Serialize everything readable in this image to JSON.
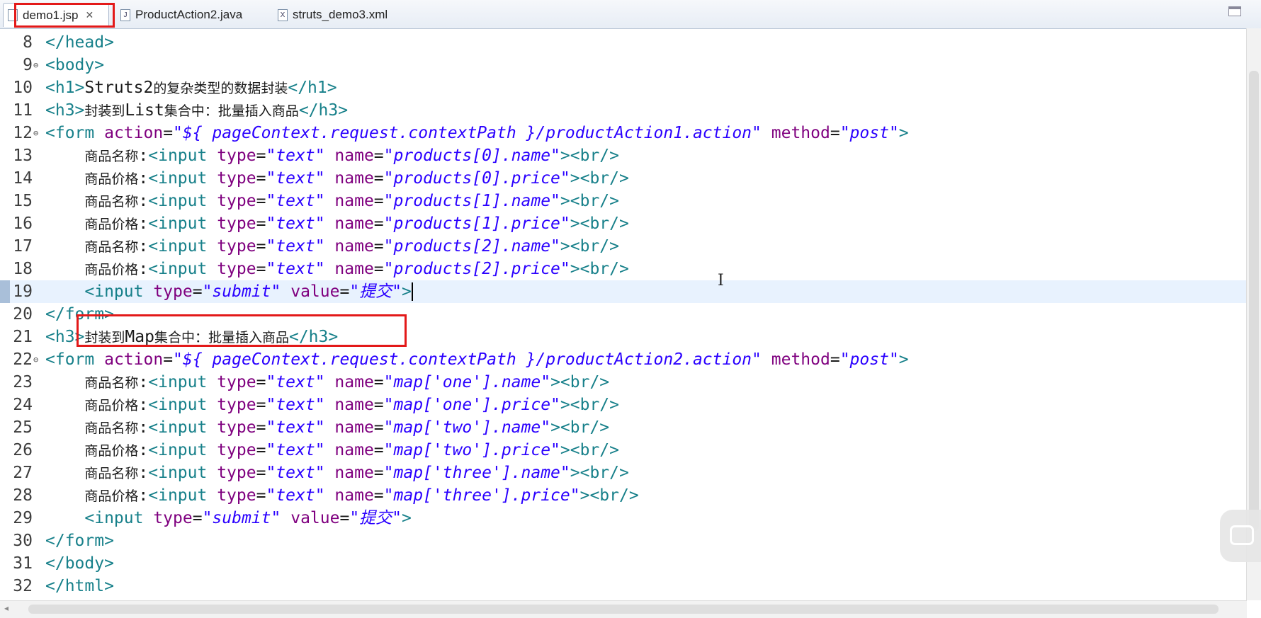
{
  "tabs": [
    {
      "label": "demo1.jsp",
      "icon": "jsp-file-icon",
      "active": true
    },
    {
      "label": "ProductAction2.java",
      "icon": "java-file-icon",
      "active": false
    },
    {
      "label": "struts_demo3.xml",
      "icon": "xml-file-icon",
      "active": false
    }
  ],
  "current_line": 19,
  "highlight_color": "#e31919",
  "lines": [
    {
      "n": "8",
      "t": [
        [
          "tag",
          "</head>"
        ]
      ]
    },
    {
      "n": "9",
      "fold": true,
      "t": [
        [
          "tag",
          "<body>"
        ]
      ]
    },
    {
      "n": "10",
      "t": [
        [
          "tag",
          "<h1>"
        ],
        [
          "txt",
          "Struts2"
        ],
        [
          "cjk",
          "的复杂类型的数据封装"
        ],
        [
          "tag",
          "</h1>"
        ]
      ]
    },
    {
      "n": "11",
      "t": [
        [
          "tag",
          "<h3>"
        ],
        [
          "cjk",
          "封装到"
        ],
        [
          "txt",
          "List"
        ],
        [
          "cjk",
          "集合中：批量插入商品"
        ],
        [
          "tag",
          "</h3>"
        ]
      ]
    },
    {
      "n": "12",
      "fold": true,
      "t": [
        [
          "tag",
          "<form "
        ],
        [
          "attr",
          "action"
        ],
        [
          "txt",
          "="
        ],
        [
          "str",
          "\"${ pageContext.request.contextPath }/productAction1.action\""
        ],
        [
          "txt",
          " "
        ],
        [
          "attr",
          "method"
        ],
        [
          "txt",
          "="
        ],
        [
          "str",
          "\"post\""
        ],
        [
          "tag",
          ">"
        ]
      ]
    },
    {
      "n": "13",
      "t": [
        [
          "txt",
          "    "
        ],
        [
          "cjk",
          "商品名称"
        ],
        [
          "txt",
          ":"
        ],
        [
          "tag",
          "<input "
        ],
        [
          "attr",
          "type"
        ],
        [
          "txt",
          "="
        ],
        [
          "str",
          "\"text\""
        ],
        [
          "txt",
          " "
        ],
        [
          "attr",
          "name"
        ],
        [
          "txt",
          "="
        ],
        [
          "str",
          "\"products[0].name\""
        ],
        [
          "tag",
          "><br/>"
        ]
      ]
    },
    {
      "n": "14",
      "t": [
        [
          "txt",
          "    "
        ],
        [
          "cjk",
          "商品价格"
        ],
        [
          "txt",
          ":"
        ],
        [
          "tag",
          "<input "
        ],
        [
          "attr",
          "type"
        ],
        [
          "txt",
          "="
        ],
        [
          "str",
          "\"text\""
        ],
        [
          "txt",
          " "
        ],
        [
          "attr",
          "name"
        ],
        [
          "txt",
          "="
        ],
        [
          "str",
          "\"products[0].price\""
        ],
        [
          "tag",
          "><br/>"
        ]
      ]
    },
    {
      "n": "15",
      "t": [
        [
          "txt",
          "    "
        ],
        [
          "cjk",
          "商品名称"
        ],
        [
          "txt",
          ":"
        ],
        [
          "tag",
          "<input "
        ],
        [
          "attr",
          "type"
        ],
        [
          "txt",
          "="
        ],
        [
          "str",
          "\"text\""
        ],
        [
          "txt",
          " "
        ],
        [
          "attr",
          "name"
        ],
        [
          "txt",
          "="
        ],
        [
          "str",
          "\"products[1].name\""
        ],
        [
          "tag",
          "><br/>"
        ]
      ]
    },
    {
      "n": "16",
      "t": [
        [
          "txt",
          "    "
        ],
        [
          "cjk",
          "商品价格"
        ],
        [
          "txt",
          ":"
        ],
        [
          "tag",
          "<input "
        ],
        [
          "attr",
          "type"
        ],
        [
          "txt",
          "="
        ],
        [
          "str",
          "\"text\""
        ],
        [
          "txt",
          " "
        ],
        [
          "attr",
          "name"
        ],
        [
          "txt",
          "="
        ],
        [
          "str",
          "\"products[1].price\""
        ],
        [
          "tag",
          "><br/>"
        ]
      ]
    },
    {
      "n": "17",
      "t": [
        [
          "txt",
          "    "
        ],
        [
          "cjk",
          "商品名称"
        ],
        [
          "txt",
          ":"
        ],
        [
          "tag",
          "<input "
        ],
        [
          "attr",
          "type"
        ],
        [
          "txt",
          "="
        ],
        [
          "str",
          "\"text\""
        ],
        [
          "txt",
          " "
        ],
        [
          "attr",
          "name"
        ],
        [
          "txt",
          "="
        ],
        [
          "str",
          "\"products[2].name\""
        ],
        [
          "tag",
          "><br/>"
        ]
      ]
    },
    {
      "n": "18",
      "t": [
        [
          "txt",
          "    "
        ],
        [
          "cjk",
          "商品价格"
        ],
        [
          "txt",
          ":"
        ],
        [
          "tag",
          "<input "
        ],
        [
          "attr",
          "type"
        ],
        [
          "txt",
          "="
        ],
        [
          "str",
          "\"text\""
        ],
        [
          "txt",
          " "
        ],
        [
          "attr",
          "name"
        ],
        [
          "txt",
          "="
        ],
        [
          "str",
          "\"products[2].price\""
        ],
        [
          "tag",
          "><br/>"
        ]
      ]
    },
    {
      "n": "19",
      "t": [
        [
          "txt",
          "    "
        ],
        [
          "tag",
          "<input "
        ],
        [
          "attr",
          "type"
        ],
        [
          "txt",
          "="
        ],
        [
          "str",
          "\"submit\""
        ],
        [
          "txt",
          " "
        ],
        [
          "attr",
          "value"
        ],
        [
          "txt",
          "="
        ],
        [
          "str",
          "\"提交\""
        ],
        [
          "tag",
          ">"
        ]
      ]
    },
    {
      "n": "20",
      "t": [
        [
          "tag",
          "</form>"
        ]
      ]
    },
    {
      "n": "21",
      "t": [
        [
          "tag",
          "<h3>"
        ],
        [
          "cjk",
          "封装到"
        ],
        [
          "txt",
          "Map"
        ],
        [
          "cjk",
          "集合中：批量插入商品"
        ],
        [
          "tag",
          "</h3>"
        ]
      ]
    },
    {
      "n": "22",
      "fold": true,
      "t": [
        [
          "tag",
          "<form "
        ],
        [
          "attr",
          "action"
        ],
        [
          "txt",
          "="
        ],
        [
          "str",
          "\"${ pageContext.request.contextPath }/productAction2.action\""
        ],
        [
          "txt",
          " "
        ],
        [
          "attr",
          "method"
        ],
        [
          "txt",
          "="
        ],
        [
          "str",
          "\"post\""
        ],
        [
          "tag",
          ">"
        ]
      ]
    },
    {
      "n": "23",
      "t": [
        [
          "txt",
          "    "
        ],
        [
          "cjk",
          "商品名称"
        ],
        [
          "txt",
          ":"
        ],
        [
          "tag",
          "<input "
        ],
        [
          "attr",
          "type"
        ],
        [
          "txt",
          "="
        ],
        [
          "str",
          "\"text\""
        ],
        [
          "txt",
          " "
        ],
        [
          "attr",
          "name"
        ],
        [
          "txt",
          "="
        ],
        [
          "str",
          "\"map['one'].name\""
        ],
        [
          "tag",
          "><br/>"
        ]
      ]
    },
    {
      "n": "24",
      "t": [
        [
          "txt",
          "    "
        ],
        [
          "cjk",
          "商品价格"
        ],
        [
          "txt",
          ":"
        ],
        [
          "tag",
          "<input "
        ],
        [
          "attr",
          "type"
        ],
        [
          "txt",
          "="
        ],
        [
          "str",
          "\"text\""
        ],
        [
          "txt",
          " "
        ],
        [
          "attr",
          "name"
        ],
        [
          "txt",
          "="
        ],
        [
          "str",
          "\"map['one'].price\""
        ],
        [
          "tag",
          "><br/>"
        ]
      ]
    },
    {
      "n": "25",
      "t": [
        [
          "txt",
          "    "
        ],
        [
          "cjk",
          "商品名称"
        ],
        [
          "txt",
          ":"
        ],
        [
          "tag",
          "<input "
        ],
        [
          "attr",
          "type"
        ],
        [
          "txt",
          "="
        ],
        [
          "str",
          "\"text\""
        ],
        [
          "txt",
          " "
        ],
        [
          "attr",
          "name"
        ],
        [
          "txt",
          "="
        ],
        [
          "str",
          "\"map['two'].name\""
        ],
        [
          "tag",
          "><br/>"
        ]
      ]
    },
    {
      "n": "26",
      "t": [
        [
          "txt",
          "    "
        ],
        [
          "cjk",
          "商品价格"
        ],
        [
          "txt",
          ":"
        ],
        [
          "tag",
          "<input "
        ],
        [
          "attr",
          "type"
        ],
        [
          "txt",
          "="
        ],
        [
          "str",
          "\"text\""
        ],
        [
          "txt",
          " "
        ],
        [
          "attr",
          "name"
        ],
        [
          "txt",
          "="
        ],
        [
          "str",
          "\"map['two'].price\""
        ],
        [
          "tag",
          "><br/>"
        ]
      ]
    },
    {
      "n": "27",
      "t": [
        [
          "txt",
          "    "
        ],
        [
          "cjk",
          "商品名称"
        ],
        [
          "txt",
          ":"
        ],
        [
          "tag",
          "<input "
        ],
        [
          "attr",
          "type"
        ],
        [
          "txt",
          "="
        ],
        [
          "str",
          "\"text\""
        ],
        [
          "txt",
          " "
        ],
        [
          "attr",
          "name"
        ],
        [
          "txt",
          "="
        ],
        [
          "str",
          "\"map['three'].name\""
        ],
        [
          "tag",
          "><br/>"
        ]
      ]
    },
    {
      "n": "28",
      "t": [
        [
          "txt",
          "    "
        ],
        [
          "cjk",
          "商品价格"
        ],
        [
          "txt",
          ":"
        ],
        [
          "tag",
          "<input "
        ],
        [
          "attr",
          "type"
        ],
        [
          "txt",
          "="
        ],
        [
          "str",
          "\"text\""
        ],
        [
          "txt",
          " "
        ],
        [
          "attr",
          "name"
        ],
        [
          "txt",
          "="
        ],
        [
          "str",
          "\"map['three'].price\""
        ],
        [
          "tag",
          "><br/>"
        ]
      ]
    },
    {
      "n": "29",
      "t": [
        [
          "txt",
          "    "
        ],
        [
          "tag",
          "<input "
        ],
        [
          "attr",
          "type"
        ],
        [
          "txt",
          "="
        ],
        [
          "str",
          "\"submit\""
        ],
        [
          "txt",
          " "
        ],
        [
          "attr",
          "value"
        ],
        [
          "txt",
          "="
        ],
        [
          "str",
          "\"提交\""
        ],
        [
          "tag",
          ">"
        ]
      ]
    },
    {
      "n": "30",
      "t": [
        [
          "tag",
          "</form>"
        ]
      ]
    },
    {
      "n": "31",
      "t": [
        [
          "tag",
          "</body>"
        ]
      ]
    },
    {
      "n": "32",
      "t": [
        [
          "tag",
          "</html>"
        ]
      ]
    }
  ]
}
